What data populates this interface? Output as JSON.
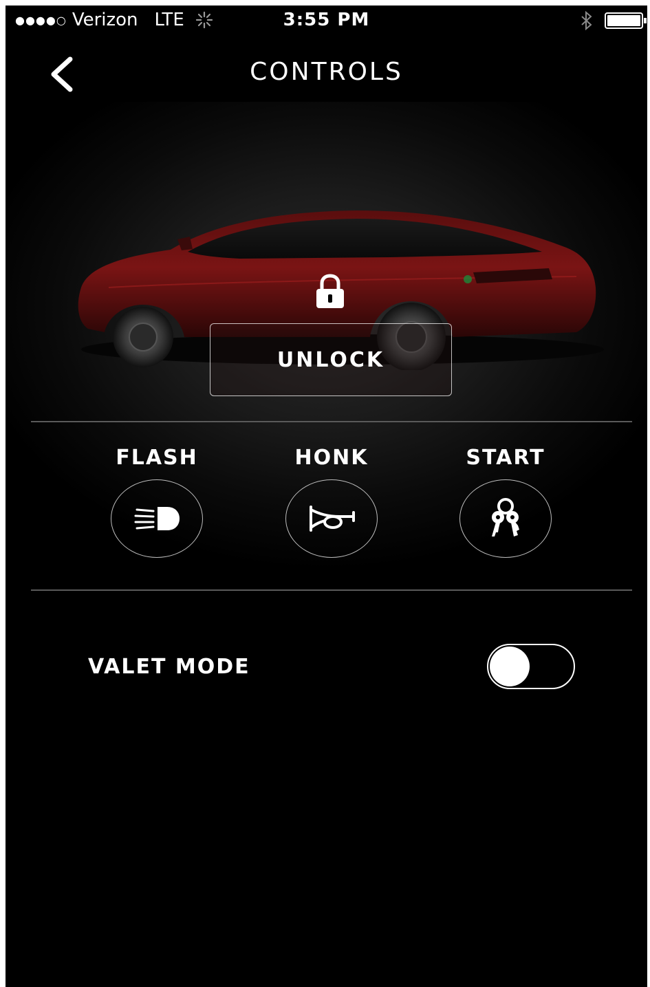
{
  "status_bar": {
    "signal": "●●●●○",
    "carrier": "Verizon",
    "network": "LTE",
    "time": "3:55 PM"
  },
  "header": {
    "title": "CONTROLS"
  },
  "car": {
    "lock_state_action": "UNLOCK",
    "body_color": "#8a1a1a"
  },
  "controls": [
    {
      "label": "FLASH",
      "icon": "headlight-icon"
    },
    {
      "label": "HONK",
      "icon": "horn-icon"
    },
    {
      "label": "START",
      "icon": "keys-icon"
    }
  ],
  "valet_mode": {
    "label": "VALET MODE",
    "enabled": false
  }
}
